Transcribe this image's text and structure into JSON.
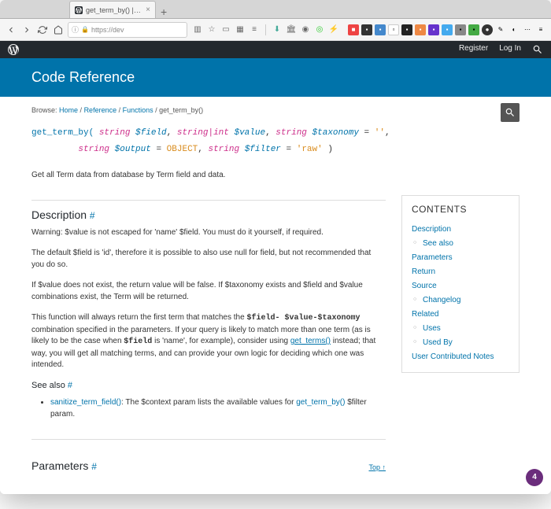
{
  "browser": {
    "tab_title": "get_term_by() | Function | Wor…",
    "url": "https://dev",
    "new_tab": "+"
  },
  "wp_admin": {
    "register": "Register",
    "login": "Log In"
  },
  "header": {
    "site_title": "Code Reference"
  },
  "breadcrumb": {
    "label": "Browse:",
    "items": [
      "Home",
      "Reference",
      "Functions",
      "get_term_by()"
    ]
  },
  "signature": {
    "fn": "get_term_by(",
    "p1_type": "string",
    "p1_name": "$field",
    "p2_type": "string|int",
    "p2_name": "$value",
    "p3_type": "string",
    "p3_name": "$taxonomy",
    "p3_def": "''",
    "p4_type": "string",
    "p4_name": "$output",
    "p4_def": "OBJECT",
    "p5_type": "string",
    "p5_name": "$filter",
    "p5_def": "'raw'",
    "close": ")"
  },
  "summary": "Get all Term data from database by Term field and data.",
  "sections": {
    "description_h": "Description",
    "hash": "#",
    "d_p1": "Warning: $value is not escaped for 'name' $field. You must do it yourself, if required.",
    "d_p2": "The default $field is 'id', therefore it is possible to also use null for field, but not recommended that you do so.",
    "d_p3": "If $value does not exist, the return value will be false. If $taxonomy exists and $field and $value combinations exist, the Term will be returned.",
    "d_p4a": "This function will always return the first term that matches the ",
    "d_p4_code": "$field- $value-$taxonomy",
    "d_p4b": " combination specified in the parameters. If your query is likely to match more than one term (as is likely to be the case when ",
    "d_p4_code2": "$field",
    "d_p4c": " is 'name', for example), consider using ",
    "d_p4_link": "get_terms()",
    "d_p4d": " instead; that way, you will get all matching terms, and can provide your own logic for deciding which one was intended.",
    "seealso_h": "See also",
    "seealso_link": "sanitize_term_field()",
    "seealso_text": ": The $context param lists the available values for ",
    "seealso_link2": "get_term_by()",
    "seealso_text2": " $filter param.",
    "params_h": "Parameters"
  },
  "toc": {
    "title": "CONTENTS",
    "items": {
      "description": "Description",
      "seealso": "See also",
      "parameters": "Parameters",
      "return": "Return",
      "source": "Source",
      "changelog": "Changelog",
      "related": "Related",
      "uses": "Uses",
      "usedby": "Used By",
      "contrib": "User Contributed Notes"
    }
  },
  "top_link": "Top ↑",
  "fab_count": "4"
}
